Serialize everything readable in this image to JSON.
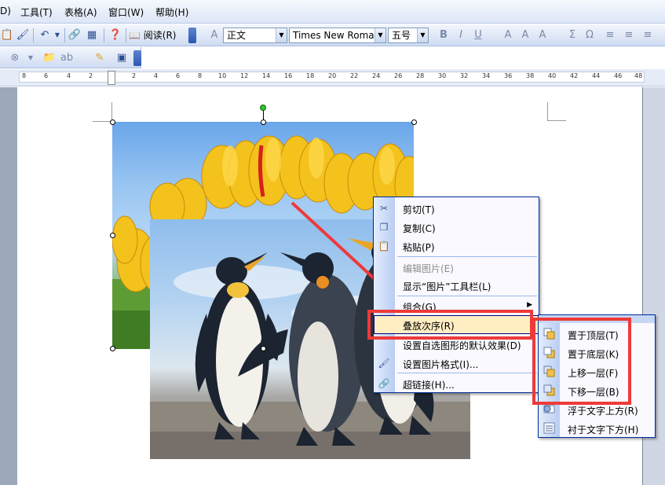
{
  "menubar": {
    "items": [
      "D)",
      "工具(T)",
      "表格(A)",
      "窗口(W)",
      "帮助(H)"
    ]
  },
  "toolbar": {
    "read_label": "阅读(R)",
    "style_value": "正文",
    "font_value": "Times New Roman",
    "size_value": "五号",
    "icons": [
      "bold-icon",
      "italic-icon",
      "underline-icon",
      "font-color-icon",
      "sum-icon",
      "omega-icon"
    ]
  },
  "ruler": {
    "left_numbers": [
      "8",
      "6",
      "4",
      "2",
      "2"
    ],
    "right_numbers": [
      "2",
      "4",
      "6",
      "8",
      "10",
      "12",
      "14",
      "16",
      "18",
      "20",
      "22",
      "24",
      "26",
      "28",
      "30",
      "32",
      "34",
      "36",
      "38",
      "40",
      "42",
      "44",
      "46",
      "48"
    ]
  },
  "context_menu": {
    "items": [
      {
        "label": "剪切(T)",
        "icon": "scissors-icon",
        "disabled": false
      },
      {
        "label": "复制(C)",
        "icon": "copy-icon",
        "disabled": false
      },
      {
        "label": "粘贴(P)",
        "icon": "paste-icon",
        "disabled": false
      },
      {
        "label": "编辑图片(E)",
        "icon": "",
        "disabled": true
      },
      {
        "label": "显示“图片”工具栏(L)",
        "icon": "",
        "disabled": false
      },
      {
        "label": "组合(G)",
        "icon": "",
        "disabled": false,
        "has_submenu": true
      },
      {
        "label": "叠放次序(R)",
        "icon": "",
        "disabled": false,
        "highlighted": true,
        "has_submenu": true
      },
      {
        "label": "设置自选图形的默认效果(D)",
        "icon": "",
        "disabled": false
      },
      {
        "label": "设置图片格式(I)...",
        "icon": "format-picture-icon",
        "disabled": false
      },
      {
        "label": "超链接(H)...",
        "icon": "hyperlink-icon",
        "disabled": false
      }
    ]
  },
  "submenu": {
    "items": [
      {
        "label": "置于顶层(T)",
        "icon": "bring-to-front-icon"
      },
      {
        "label": "置于底层(K)",
        "icon": "send-to-back-icon"
      },
      {
        "label": "上移一层(F)",
        "icon": "bring-forward-icon"
      },
      {
        "label": "下移一层(B)",
        "icon": "send-backward-icon"
      },
      {
        "label": "浮于文字上方(R)",
        "icon": "in-front-of-text-icon"
      },
      {
        "label": "衬于文字下方(H)",
        "icon": "behind-text-icon"
      }
    ]
  },
  "colors": {
    "annotation_red": "#ee3a3a",
    "menu_highlight": "#ffeec2"
  }
}
